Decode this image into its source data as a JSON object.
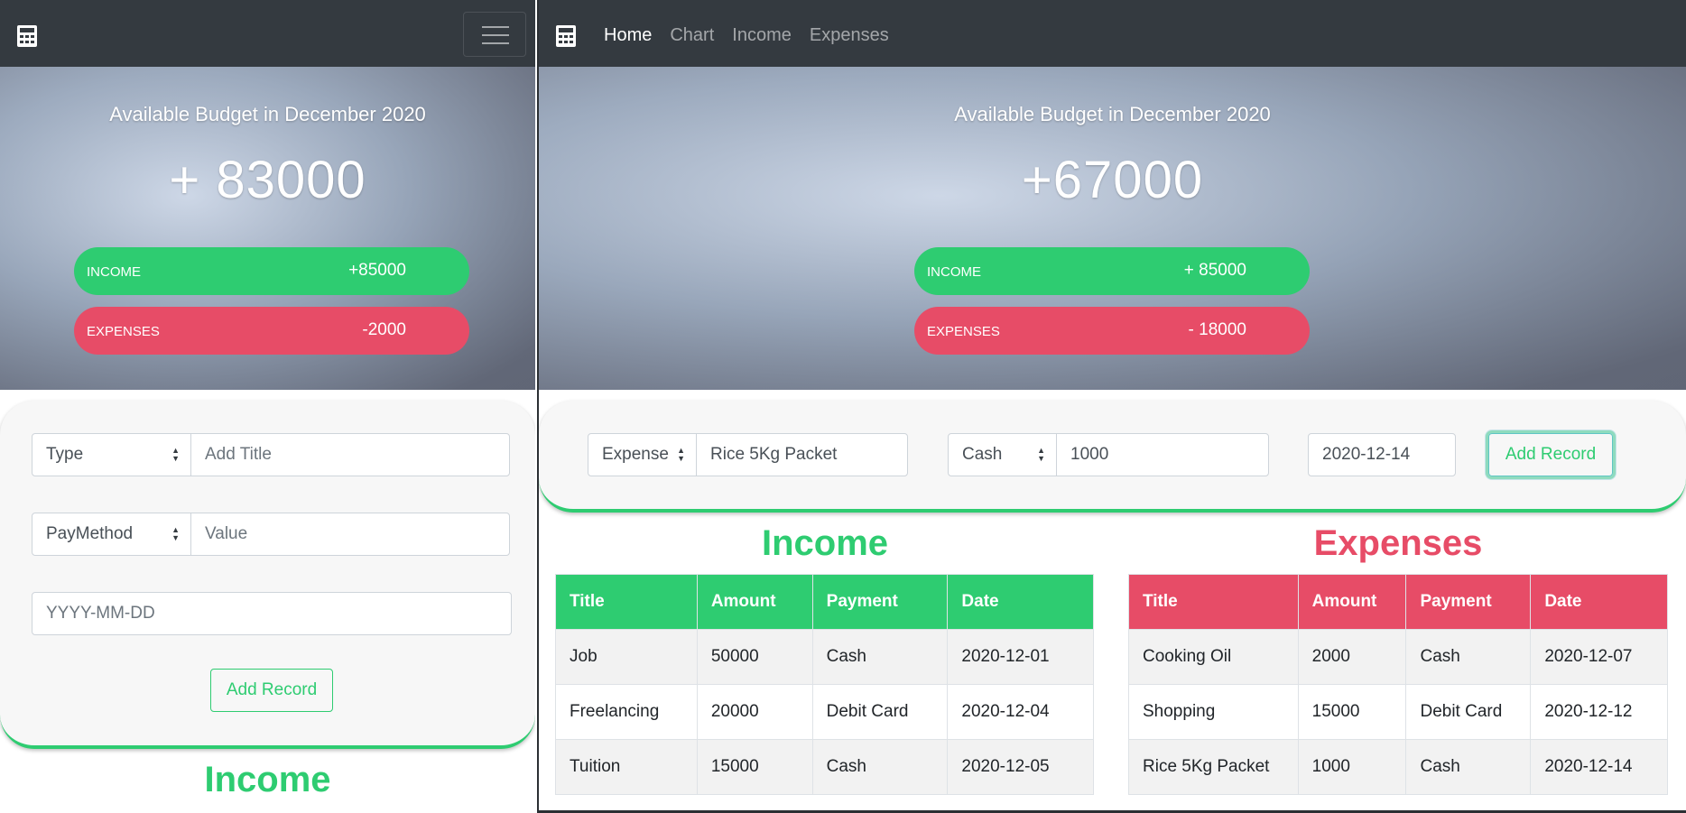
{
  "colors": {
    "navbar": "#343a40",
    "income": "#2ecc71",
    "expenses": "#e74c67"
  },
  "left": {
    "hero": {
      "title": "Available Budget in December 2020",
      "amount": "+ 83000"
    },
    "income": {
      "label": "INCOME",
      "value": "+85000"
    },
    "expenses": {
      "label": "EXPENSES",
      "value": "-2000"
    },
    "form": {
      "type_select": "Type",
      "title_placeholder": "Add Title",
      "paymethod_select": "PayMethod",
      "value_placeholder": "Value",
      "date_placeholder": "YYYY-MM-DD",
      "add_button": "Add Record"
    },
    "income_heading": "Income"
  },
  "right": {
    "nav": [
      "Home",
      "Chart",
      "Income",
      "Expenses"
    ],
    "hero": {
      "title": "Available Budget in December 2020",
      "amount": "+67000"
    },
    "income": {
      "label": "INCOME",
      "value": "+ 85000"
    },
    "expenses": {
      "label": "EXPENSES",
      "value": "- 18000"
    },
    "form": {
      "type_select": "Expense",
      "title_value": "Rice 5Kg Packet",
      "paymethod_select": "Cash",
      "value_value": "1000",
      "date_value": "2020-12-14",
      "add_button": "Add Record"
    },
    "income_heading": "Income",
    "expenses_heading": "Expenses",
    "income_table": {
      "headers": [
        "Title",
        "Amount",
        "Payment",
        "Date"
      ],
      "rows": [
        [
          "Job",
          "50000",
          "Cash",
          "2020-12-01"
        ],
        [
          "Freelancing",
          "20000",
          "Debit Card",
          "2020-12-04"
        ],
        [
          "Tuition",
          "15000",
          "Cash",
          "2020-12-05"
        ]
      ]
    },
    "expenses_table": {
      "headers": [
        "Title",
        "Amount",
        "Payment",
        "Date"
      ],
      "rows": [
        [
          "Cooking Oil",
          "2000",
          "Cash",
          "2020-12-07"
        ],
        [
          "Shopping",
          "15000",
          "Debit Card",
          "2020-12-12"
        ],
        [
          "Rice 5Kg Packet",
          "1000",
          "Cash",
          "2020-12-14"
        ]
      ]
    }
  }
}
